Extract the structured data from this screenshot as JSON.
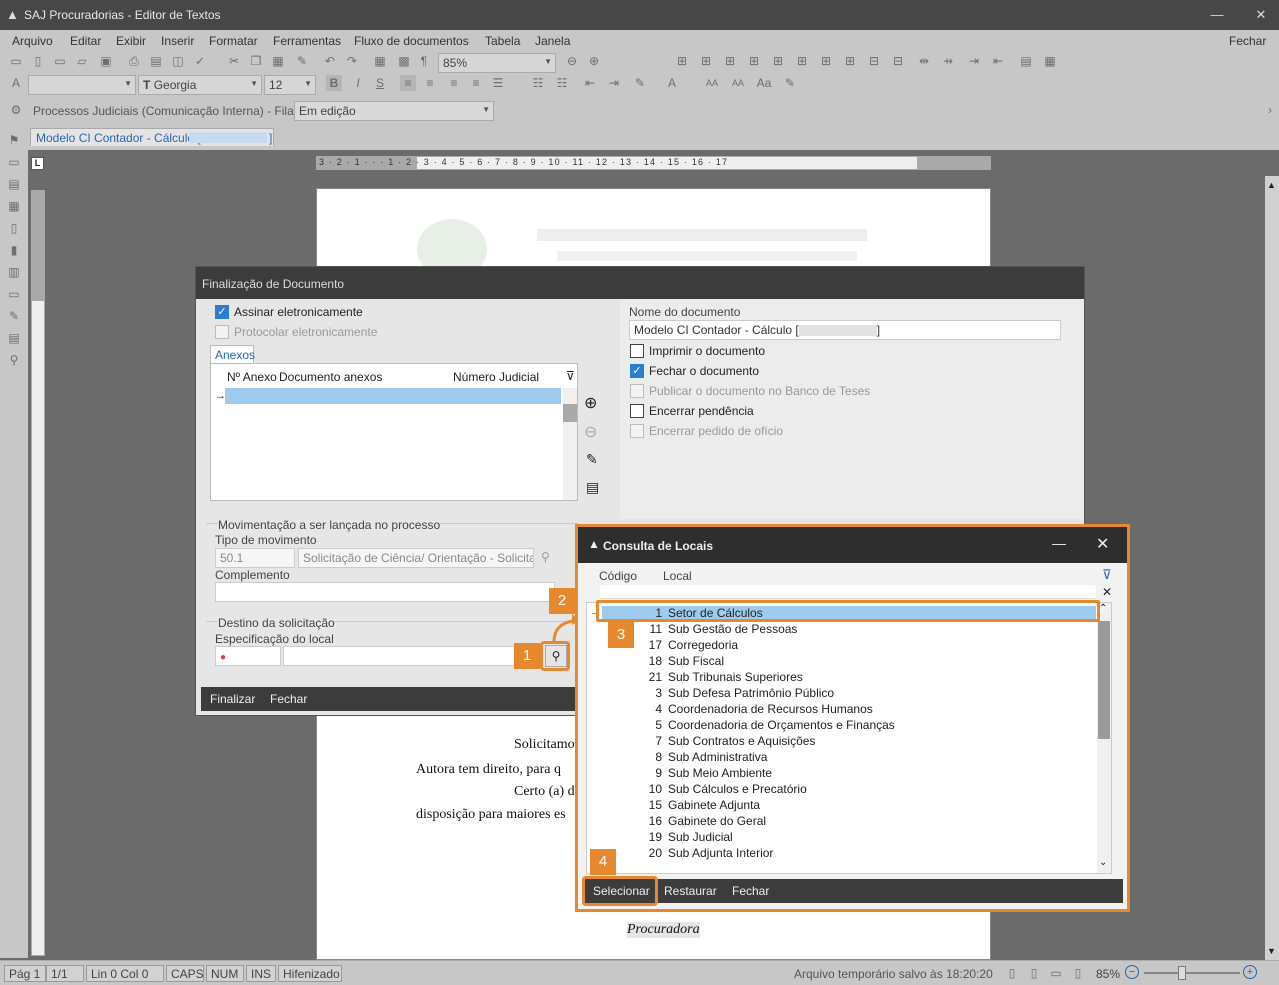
{
  "window": {
    "title": "SAJ Procuradorias - Editor de Textos",
    "minimize": "—",
    "close": "✕"
  },
  "menu": {
    "items": [
      "Arquivo",
      "Editar",
      "Exibir",
      "Inserir",
      "Formatar",
      "Ferramentas",
      "Fluxo de documentos",
      "Tabela",
      "Janela"
    ],
    "close_label": "Fechar"
  },
  "toolbar": {
    "zoom_value": "85%",
    "font_name": "Georgia",
    "font_size": "12",
    "process_label": "Processos Judiciais (Comunicação Interna) - Fila:",
    "queue_value": "Em edição",
    "doc_tab": "Modelo CI Contador - Cálculo ["
  },
  "ruler": {
    "ticks": "3 · 2 · 1 · · · 1 · 2 · 3 · 4 · 5 · 6 · 7 · 8 · 9 · 10 · 11 · 12 · 13 · 14 · 15 · 16 · 17"
  },
  "document": {
    "line1": "Solicitamo",
    "line2": "Autora tem direito, para q",
    "line3": "Certo (a) d",
    "line4": "disposição para maiores es",
    "signature": "Procuradora"
  },
  "finalizacao": {
    "title": "Finalização de Documento",
    "assinar_label": "Assinar eletronicamente",
    "protocolar_label": "Protocolar eletronicamente",
    "anexos_tab": "Anexos",
    "col_nr": "Nº Anexo",
    "col_doc": "Documento anexos",
    "col_num": "Número Judicial",
    "nome_doc_label": "Nome do documento",
    "nome_doc_value": "Modelo CI Contador - Cálculo [",
    "nome_doc_suffix": "]",
    "imprimir_label": "Imprimir o documento",
    "fechar_doc_label": "Fechar o documento",
    "publicar_label": "Publicar o documento no Banco de Teses",
    "encerrar_pend_label": "Encerrar pendência",
    "encerrar_oficio_label": "Encerrar pedido de ofício",
    "mov_group": "Movimentação a ser lançada no processo",
    "tipo_mov_label": "Tipo de movimento",
    "tipo_mov_code": "50.1",
    "tipo_mov_desc": "Solicitação de Ciência/ Orientação - Solicitaçã",
    "complemento_label": "Complemento",
    "destino_group": "Destino da solicitação",
    "especificacao_label": "Especificação do local",
    "finalizar_btn": "Finalizar",
    "fechar_btn": "Fechar"
  },
  "consulta": {
    "title": "Consulta de Locais",
    "col_codigo": "Código",
    "col_local": "Local",
    "rows": [
      {
        "code": "1",
        "name": "Setor de Cálculos"
      },
      {
        "code": "11",
        "name": "Sub Gestão de Pessoas"
      },
      {
        "code": "17",
        "name": "Corregedoria"
      },
      {
        "code": "18",
        "name": "Sub Fiscal"
      },
      {
        "code": "21",
        "name": "Sub Tribunais Superiores"
      },
      {
        "code": "3",
        "name": "Sub Defesa Patrimônio Público"
      },
      {
        "code": "4",
        "name": "Coordenadoria de Recursos Humanos"
      },
      {
        "code": "5",
        "name": "Coordenadoria de Orçamentos e Finanças"
      },
      {
        "code": "7",
        "name": "Sub Contratos e Aquisições"
      },
      {
        "code": "8",
        "name": "Sub Administrativa"
      },
      {
        "code": "9",
        "name": "Sub Meio Ambiente"
      },
      {
        "code": "10",
        "name": "Sub Cálculos e Precatório"
      },
      {
        "code": "15",
        "name": "Gabinete Adjunta"
      },
      {
        "code": "16",
        "name": "Gabinete do Geral"
      },
      {
        "code": "19",
        "name": "Sub Judicial"
      },
      {
        "code": "20",
        "name": "Sub Adjunta Interior"
      }
    ],
    "selecionar_btn": "Selecionar",
    "restaurar_btn": "Restaurar",
    "fechar_btn": "Fechar"
  },
  "callouts": [
    "1",
    "2",
    "3",
    "4"
  ],
  "status": {
    "pag": "Pág 1",
    "pages": "1/1",
    "lincol": "Lin 0  Col 0",
    "caps": "CAPS",
    "num": "NUM",
    "ins": "INS",
    "hifen": "Hifenizado",
    "saved": "Arquivo temporário salvo às 18:20:20",
    "zoom": "85%"
  },
  "colors": {
    "accent": "#e8882e",
    "selection": "#9fcbef",
    "dark": "#3c3c3c"
  }
}
